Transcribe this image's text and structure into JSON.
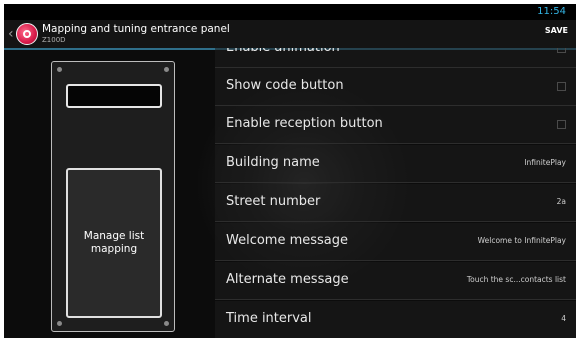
{
  "status_bar": {
    "time": "11:54"
  },
  "action_bar": {
    "title": "Mapping and tuning entrance panel",
    "subtitle": "Z100D",
    "save_label": "SAVE",
    "app_icon": "app-logo-icon",
    "up_icon": "chevron-left-icon"
  },
  "device_panel": {
    "manage_button_label": "Manage list mapping"
  },
  "settings": [
    {
      "label": "Enable animation",
      "value": "",
      "type": "checkbox",
      "checked": false
    },
    {
      "label": "Show code button",
      "value": "",
      "type": "checkbox",
      "checked": false
    },
    {
      "label": "Enable reception button",
      "value": "",
      "type": "checkbox",
      "checked": false
    },
    {
      "label": "Building name",
      "value": "InfinitePlay",
      "type": "text"
    },
    {
      "label": "Street number",
      "value": "2a",
      "type": "text"
    },
    {
      "label": "Welcome message",
      "value": "Welcome to InfinitePlay",
      "type": "text"
    },
    {
      "label": "Alternate message",
      "value": "Touch the sc...contacts list",
      "type": "text"
    },
    {
      "label": "Time interval",
      "value": "4",
      "type": "text"
    }
  ],
  "colors": {
    "accent": "#33b5e5",
    "divider": "#2f6f8a",
    "background": "#0c0c0c"
  }
}
